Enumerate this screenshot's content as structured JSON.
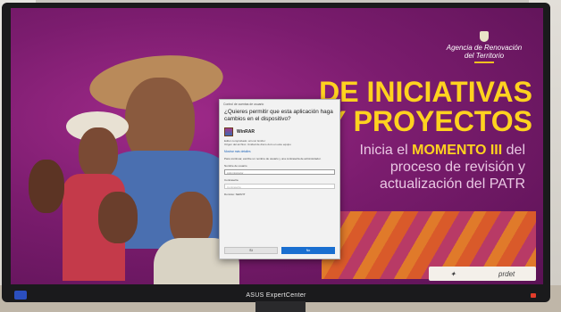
{
  "poster": {
    "agency": {
      "line1": "Agencia de Renovación",
      "line2": "del Territorio"
    },
    "headline": {
      "line1": "DE INICIATIVAS",
      "line2": "Y PROYECTOS"
    },
    "subtitle": {
      "pre": "Inicia el ",
      "bold": "MOMENTO III",
      "post": " del proceso de revisión y actualización del PATR"
    },
    "sponsor_logo": "prdet"
  },
  "dialog": {
    "title_bar": "Control de cuentas de usuario",
    "question": "¿Quieres permitir que esta aplicación haga cambios en el dispositivo?",
    "app_name": "WinRAR",
    "publisher": "Editor comprobado: win.rar GmbH",
    "origin": "Origen del archivo: Unidad de disco duro en este equipo",
    "more_details": "Mostrar más detalles",
    "cred_prompt": "Para continuar, escribe un nombre de usuario y una contraseña de administrador.",
    "username_label": "Nombre de usuario",
    "username_value": "Administrador",
    "password_label": "Contraseña",
    "password_placeholder": "Contraseña",
    "domain": "Dominio: SERVIT",
    "btn_yes": "Sí",
    "btn_no": "No"
  },
  "monitor": {
    "brand": "ASUS ExpertCenter"
  },
  "colors": {
    "screen_bg": "#7b1c6e",
    "headline": "#ffd21f",
    "primary_button": "#1a6fd0"
  }
}
